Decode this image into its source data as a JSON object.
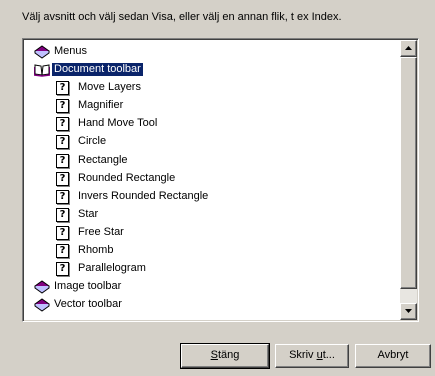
{
  "instruction": "Välj avsnitt och välj sedan Visa, eller välj en annan flik, t ex Index.",
  "tree": [
    {
      "label": "Menus",
      "icon": "closed-book-icon",
      "level": 0,
      "selected": false
    },
    {
      "label": "Document toolbar",
      "icon": "open-book-icon",
      "level": 0,
      "selected": true
    },
    {
      "label": "Move Layers",
      "icon": "help-page-icon",
      "level": 1,
      "selected": false
    },
    {
      "label": "Magnifier",
      "icon": "help-page-icon",
      "level": 1,
      "selected": false
    },
    {
      "label": "Hand Move Tool",
      "icon": "help-page-icon",
      "level": 1,
      "selected": false
    },
    {
      "label": "Circle",
      "icon": "help-page-icon",
      "level": 1,
      "selected": false
    },
    {
      "label": "Rectangle",
      "icon": "help-page-icon",
      "level": 1,
      "selected": false
    },
    {
      "label": "Rounded Rectangle",
      "icon": "help-page-icon",
      "level": 1,
      "selected": false
    },
    {
      "label": "Invers Rounded Rectangle",
      "icon": "help-page-icon",
      "level": 1,
      "selected": false
    },
    {
      "label": "Star",
      "icon": "help-page-icon",
      "level": 1,
      "selected": false
    },
    {
      "label": "Free Star",
      "icon": "help-page-icon",
      "level": 1,
      "selected": false
    },
    {
      "label": "Rhomb",
      "icon": "help-page-icon",
      "level": 1,
      "selected": false
    },
    {
      "label": "Parallelogram",
      "icon": "help-page-icon",
      "level": 1,
      "selected": false
    },
    {
      "label": "Image toolbar",
      "icon": "closed-book-icon",
      "level": 0,
      "selected": false
    },
    {
      "label": "Vector toolbar",
      "icon": "closed-book-icon",
      "level": 0,
      "selected": false
    }
  ],
  "buttons": {
    "close": {
      "pre": "",
      "ul": "S",
      "post": "täng"
    },
    "print": {
      "pre": "Skriv ",
      "ul": "u",
      "post": "t..."
    },
    "cancel": {
      "pre": "Avbryt",
      "ul": "",
      "post": ""
    }
  },
  "colors": {
    "selection": "#0a246a",
    "book": "#800080",
    "dialog_bg": "#d4d0c8"
  }
}
